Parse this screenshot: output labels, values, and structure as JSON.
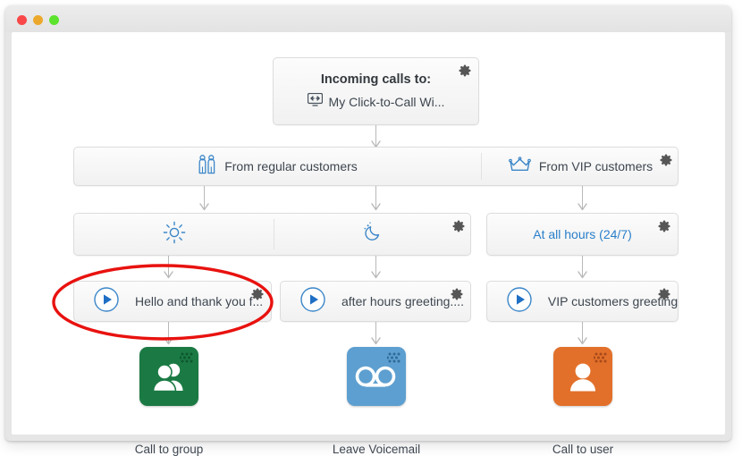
{
  "window": {
    "buttons": [
      {
        "name": "close",
        "color": "#f9484a"
      },
      {
        "name": "minimize",
        "color": "#eca82c"
      },
      {
        "name": "zoom",
        "color": "#5ce32d"
      }
    ]
  },
  "flow": {
    "root": {
      "title": "Incoming calls to:",
      "subtitle": "My Click-to-Call Wi...",
      "icon": "monitor-click-to-call-icon",
      "gear": "gear-icon"
    },
    "audience": [
      {
        "label": "From regular customers",
        "icon": "two-people-icon",
        "gear": null
      },
      {
        "label": "From VIP customers",
        "icon": "crown-icon",
        "gear": "gear-icon"
      }
    ],
    "schedule": [
      {
        "label": "",
        "icon": "sun-icon",
        "gear": null
      },
      {
        "label": "",
        "icon": "moon-icon",
        "gear": "gear-icon"
      },
      {
        "label": "At all hours (24/7)",
        "icon": null,
        "gear": "gear-icon"
      }
    ],
    "greetings": [
      {
        "label": "Hello and thank you f...",
        "icon": "play-icon",
        "gear": "gear-icon",
        "highlighted": true
      },
      {
        "label": "after hours greeting....",
        "icon": "play-icon",
        "gear": "gear-icon",
        "highlighted": false
      },
      {
        "label": "VIP customers greeting",
        "icon": "play-icon",
        "gear": "gear-icon",
        "highlighted": false
      }
    ],
    "actions": [
      {
        "caption": "Call to group",
        "icon": "group-of-people-icon",
        "color": "#1b7a44",
        "handle": "dot-grid-handle-icon"
      },
      {
        "caption": "Leave Voicemail",
        "icon": "voicemail-icon",
        "color": "#5d9fd0",
        "handle": "dot-grid-handle-icon"
      },
      {
        "caption": "Call to user",
        "icon": "single-person-icon",
        "color": "#e2702a",
        "handle": "dot-grid-handle-icon"
      }
    ]
  },
  "annotation": {
    "shape": "ellipse",
    "color": "#e8120f",
    "target": "Hello and thank you f..."
  },
  "colors": {
    "accent_blue": "#2a7fc9",
    "text": "#3e4650",
    "connector": "#b9b9b9",
    "box_border": "#dcdcdc"
  }
}
